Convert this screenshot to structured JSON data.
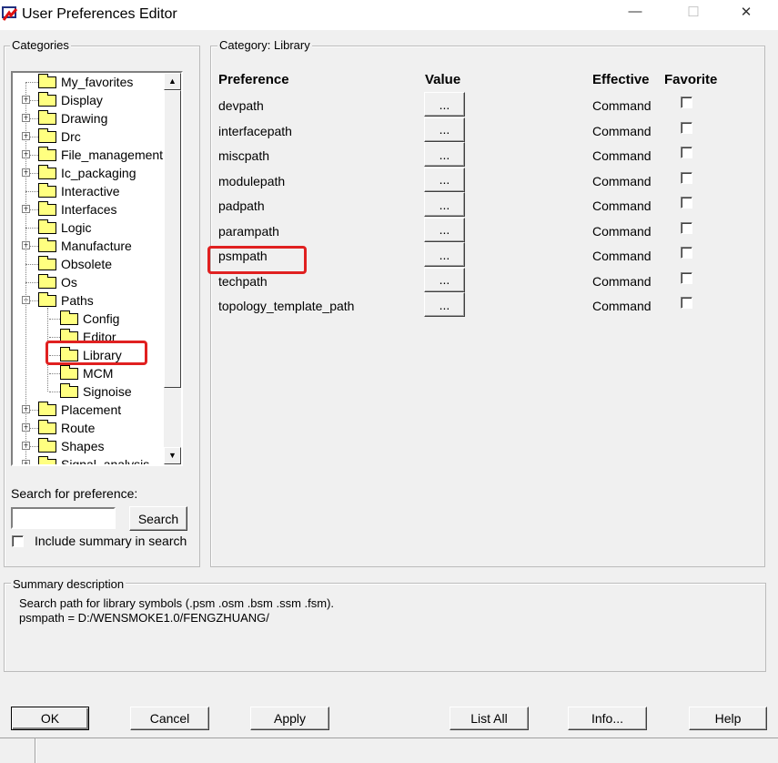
{
  "window": {
    "title": "User Preferences Editor",
    "minimize": "—",
    "maximize": "☐",
    "close": "✕"
  },
  "categories": {
    "label": "Categories",
    "tree": [
      {
        "label": "My_favorites",
        "level": 0,
        "expander": ""
      },
      {
        "label": "Display",
        "level": 0,
        "expander": "+"
      },
      {
        "label": "Drawing",
        "level": 0,
        "expander": "+"
      },
      {
        "label": "Drc",
        "level": 0,
        "expander": "+"
      },
      {
        "label": "File_management",
        "level": 0,
        "expander": "+"
      },
      {
        "label": "Ic_packaging",
        "level": 0,
        "expander": "+"
      },
      {
        "label": "Interactive",
        "level": 0,
        "expander": ""
      },
      {
        "label": "Interfaces",
        "level": 0,
        "expander": "+"
      },
      {
        "label": "Logic",
        "level": 0,
        "expander": ""
      },
      {
        "label": "Manufacture",
        "level": 0,
        "expander": "+"
      },
      {
        "label": "Obsolete",
        "level": 0,
        "expander": ""
      },
      {
        "label": "Os",
        "level": 0,
        "expander": ""
      },
      {
        "label": "Paths",
        "level": 0,
        "expander": "-"
      },
      {
        "label": "Config",
        "level": 1,
        "expander": ""
      },
      {
        "label": "Editor",
        "level": 1,
        "expander": ""
      },
      {
        "label": "Library",
        "level": 1,
        "expander": "",
        "selected": true
      },
      {
        "label": "MCM",
        "level": 1,
        "expander": ""
      },
      {
        "label": "Signoise",
        "level": 1,
        "expander": ""
      },
      {
        "label": "Placement",
        "level": 0,
        "expander": "+"
      },
      {
        "label": "Route",
        "level": 0,
        "expander": "+"
      },
      {
        "label": "Shapes",
        "level": 0,
        "expander": "+"
      },
      {
        "label": "Signal_analysis",
        "level": 0,
        "expander": "+"
      }
    ],
    "search_label": "Search for preference:",
    "search_value": "",
    "search_button": "Search",
    "include_summary": "Include summary in search",
    "include_summary_checked": false
  },
  "category_panel": {
    "label": "Category:  Library",
    "headers": {
      "preference": "Preference",
      "value": "Value",
      "effective": "Effective",
      "favorite": "Favorite"
    },
    "rows": [
      {
        "name": "devpath",
        "value": "...",
        "effective": "Command",
        "favorite": false
      },
      {
        "name": "interfacepath",
        "value": "...",
        "effective": "Command",
        "favorite": false
      },
      {
        "name": "miscpath",
        "value": "...",
        "effective": "Command",
        "favorite": false
      },
      {
        "name": "modulepath",
        "value": "...",
        "effective": "Command",
        "favorite": false
      },
      {
        "name": "padpath",
        "value": "...",
        "effective": "Command",
        "favorite": false
      },
      {
        "name": "parampath",
        "value": "...",
        "effective": "Command",
        "favorite": false
      },
      {
        "name": "psmpath",
        "value": "...",
        "effective": "Command",
        "favorite": false,
        "highlighted": true
      },
      {
        "name": "techpath",
        "value": "...",
        "effective": "Command",
        "favorite": false
      },
      {
        "name": "topology_template_path",
        "value": "...",
        "effective": "Command",
        "favorite": false
      }
    ]
  },
  "summary": {
    "label": "Summary description",
    "line1": "Search path for library symbols (.psm .osm .bsm .ssm .fsm).",
    "line2": "psmpath = D:/WENSMOKE1.0/FENGZHUANG/"
  },
  "buttons": {
    "ok": "OK",
    "cancel": "Cancel",
    "apply": "Apply",
    "list_all": "List All",
    "info": "Info...",
    "help": "Help"
  },
  "colors": {
    "highlight": "#e02020",
    "folder": "#ffff80"
  }
}
